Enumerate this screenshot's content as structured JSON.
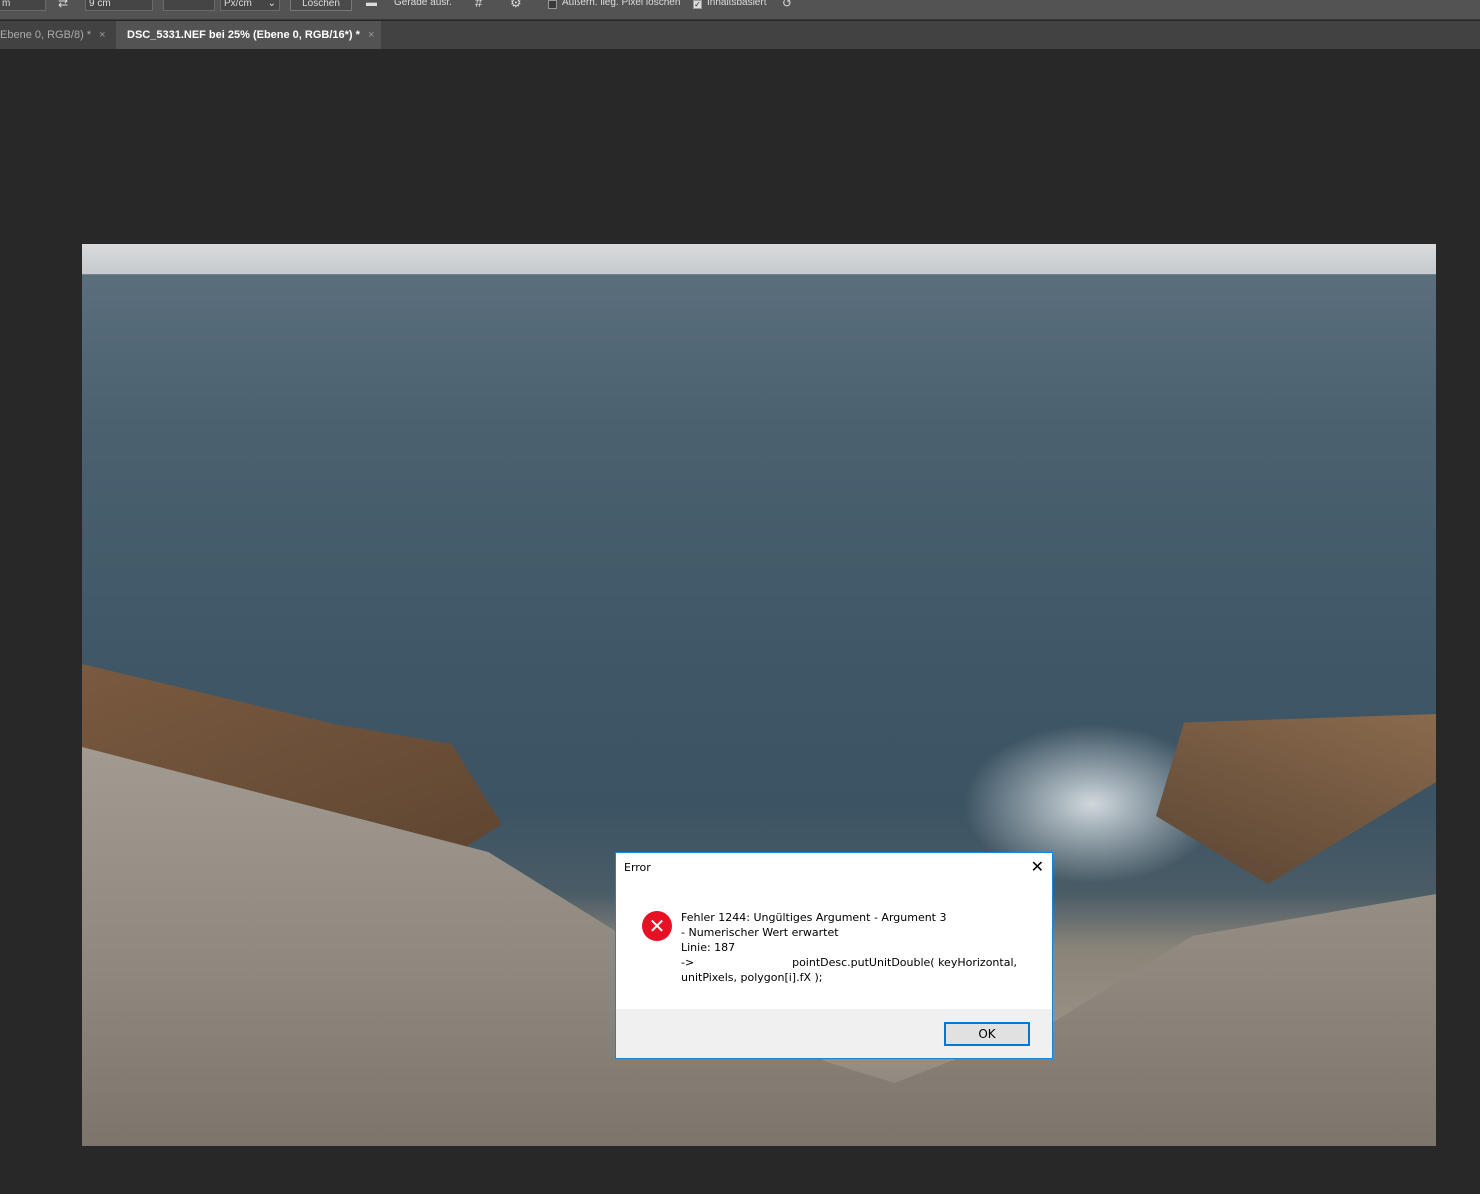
{
  "toolbar": {
    "unit_field": "m",
    "swap_icon": "swap-arrows-icon",
    "height_field": "9 cm",
    "resolution_field": "",
    "resolution_unit": "Px/cm",
    "clear_label": "Löschen",
    "straighten_icon": "straighten-icon",
    "straighten_label": "Gerade ausr.",
    "grid_icon": "grid-overlay-icon",
    "gear_icon": "gear-icon",
    "delete_cropped_label": "Außerh. lieg. Pixel löschen",
    "delete_cropped_checked": false,
    "content_aware_label": "Inhaltsbasiert",
    "content_aware_checked": true,
    "reset_icon": "reset-icon"
  },
  "tabs": [
    {
      "label": "Ebene 0, RGB/8) *",
      "close": "×",
      "active": false
    },
    {
      "label": "DSC_5331.NEF bei 25% (Ebene 0, RGB/16*) *",
      "close": "×",
      "active": true
    }
  ],
  "dialog": {
    "title": "Error",
    "close": "✕",
    "icon": "error-icon",
    "lines": [
      "Fehler 1244: Ungültiges Argument - Argument 3",
      "- Numerischer Wert erwartet",
      "Linie: 187",
      "->                            pointDesc.putUnitDouble( keyHorizontal,",
      "unitPixels, polygon[i].fX );"
    ],
    "ok_label": "OK"
  },
  "colors": {
    "accent": "#0078d7",
    "error": "#e81123",
    "canvas": "#282828"
  }
}
